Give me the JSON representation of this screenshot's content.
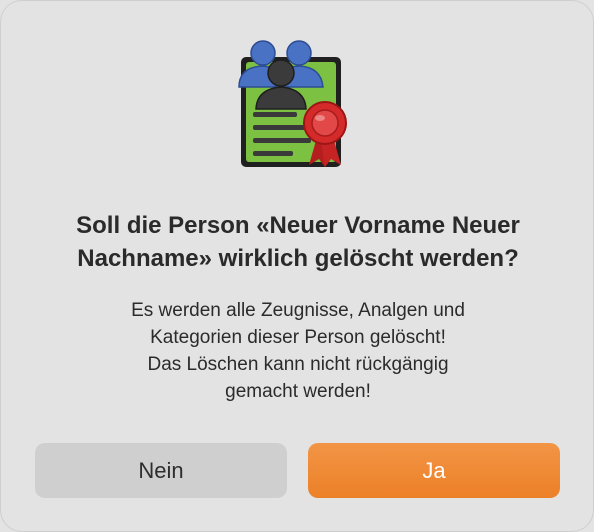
{
  "dialog": {
    "icon": "person-certificate-icon",
    "title": "Soll die Person «Neuer Vorname Neuer Nachname» wirklich gelöscht werden?",
    "message_lines": [
      "Es werden alle Zeugnisse, Analgen und",
      "Kategorien dieser Person gelöscht!",
      "Das Löschen kann nicht rückgängig",
      "gemacht werden!"
    ],
    "buttons": {
      "no_label": "Nein",
      "yes_label": "Ja"
    },
    "colors": {
      "background": "#e3e3e3",
      "default_button": "#ec8027",
      "secondary_button": "#cfcfcf",
      "certificate_green": "#7cc142",
      "people_blue": "#4a72c4",
      "seal_red": "#d42a2a"
    }
  }
}
